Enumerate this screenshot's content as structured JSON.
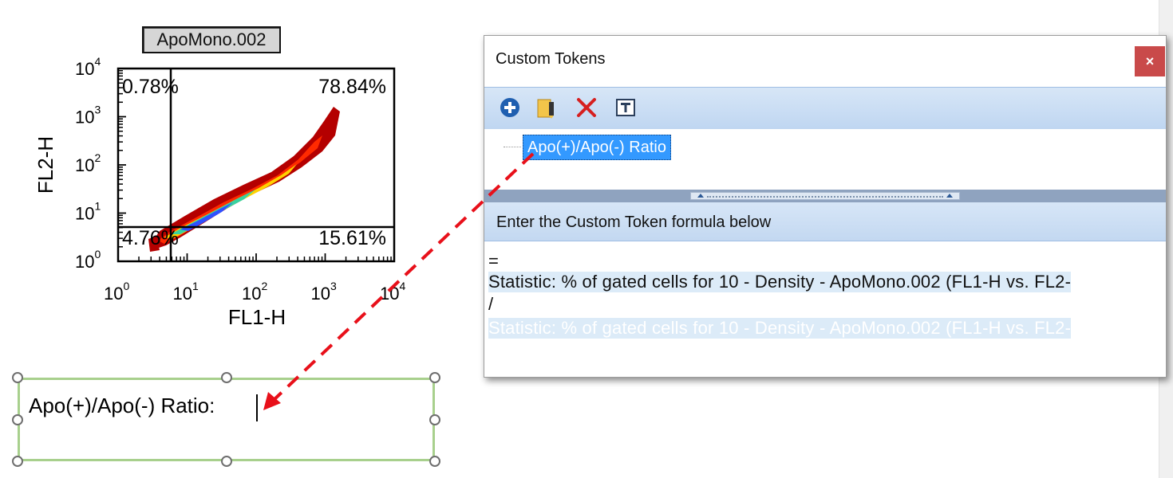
{
  "plot": {
    "title": "ApoMono.002",
    "x_label": "FL1-H",
    "y_label": "FL2-H",
    "x_ticks": [
      {
        "base": "10",
        "exp": "0"
      },
      {
        "base": "10",
        "exp": "1"
      },
      {
        "base": "10",
        "exp": "2"
      },
      {
        "base": "10",
        "exp": "3"
      },
      {
        "base": "10",
        "exp": "4"
      }
    ],
    "y_ticks": [
      {
        "base": "10",
        "exp": "0"
      },
      {
        "base": "10",
        "exp": "1"
      },
      {
        "base": "10",
        "exp": "2"
      },
      {
        "base": "10",
        "exp": "3"
      },
      {
        "base": "10",
        "exp": "4"
      }
    ],
    "quadrants": {
      "upper_left": "0.78%",
      "upper_right": "78.84%",
      "lower_left": "4.76%",
      "lower_right": "15.61%"
    },
    "colors": {
      "density_high": "#b40000",
      "density_mid": "#ff3c00",
      "density_low": "#3050ff"
    }
  },
  "textbox": {
    "text": "Apo(+)/Apo(-) Ratio:"
  },
  "dialog": {
    "title": "Custom Tokens",
    "close_glyph": "×",
    "toolbar": [
      {
        "name": "add-icon",
        "tooltip": ""
      },
      {
        "name": "edit-icon",
        "tooltip": ""
      },
      {
        "name": "delete-icon",
        "tooltip": ""
      },
      {
        "name": "token-format-icon",
        "tooltip": ""
      }
    ],
    "tree_item": "Apo(+)/Apo(-) Ratio",
    "section_label": "Enter the Custom Token formula below",
    "formula_lines": [
      "=",
      "Statistic: % of gated cells for 10 - Density - ApoMono.002 (FL1-H vs. FL2-",
      "/",
      "Statistic: % of gated cells for 10 - Density - ApoMono.002 (FL1-H vs. FL2-"
    ],
    "accent": "#3399ff",
    "close_color": "#c94a4a"
  }
}
